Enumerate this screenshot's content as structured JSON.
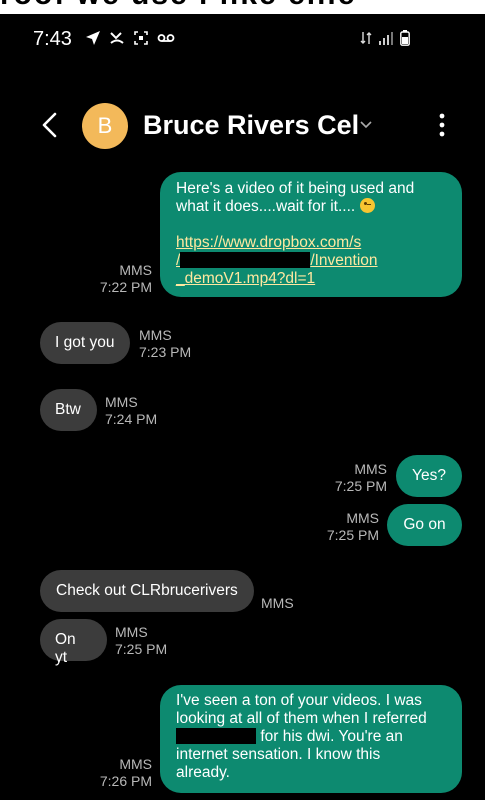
{
  "top_crop_text": "roof we use i like ellie",
  "status_bar": {
    "time": "7:43",
    "icons": [
      "navigation-icon",
      "missed-call-icon",
      "screenshot-icon",
      "voicemail-icon"
    ],
    "right_icons": [
      "sync-icon",
      "signal-icon",
      "battery-icon"
    ]
  },
  "header": {
    "avatar_letter": "B",
    "contact_name": "Bruce Rivers Cel"
  },
  "messages": [
    {
      "direction": "sent",
      "line1": "Here's a video of it being used and",
      "line2": "what it does....wait for it....",
      "link_part1": "https://www.dropbox.com/s",
      "link_part2_pre": "/",
      "link_part2_post": "/Invention",
      "link_part3": "_demoV1.mp4?dl=1",
      "type": "MMS",
      "time": "7:22 PM"
    },
    {
      "direction": "received",
      "text": "I got you",
      "type": "MMS",
      "time": "7:23 PM"
    },
    {
      "direction": "received",
      "text": "Btw",
      "type": "MMS",
      "time": "7:24 PM"
    },
    {
      "direction": "sent",
      "text": "Yes?",
      "type": "MMS",
      "time": "7:25 PM"
    },
    {
      "direction": "sent",
      "text": "Go on",
      "type": "MMS",
      "time": "7:25 PM"
    },
    {
      "direction": "received",
      "text": "Check out CLRbrucerivers",
      "type": "MMS"
    },
    {
      "direction": "received",
      "text": "On yt",
      "type": "MMS",
      "time": "7:25 PM"
    },
    {
      "direction": "sent",
      "line1": "I've seen a ton of your videos. I was",
      "line2": "looking at all of them when I referred",
      "line3_post": "for his dwi. You're an",
      "line4": "internet sensation.  I know this",
      "line5": "already.",
      "type": "MMS",
      "time": "7:26 PM"
    }
  ],
  "colors": {
    "background": "#000000",
    "sent_bubble": "#0d8a70",
    "received_bubble": "#3c3c3c",
    "avatar": "#f3b95a"
  }
}
